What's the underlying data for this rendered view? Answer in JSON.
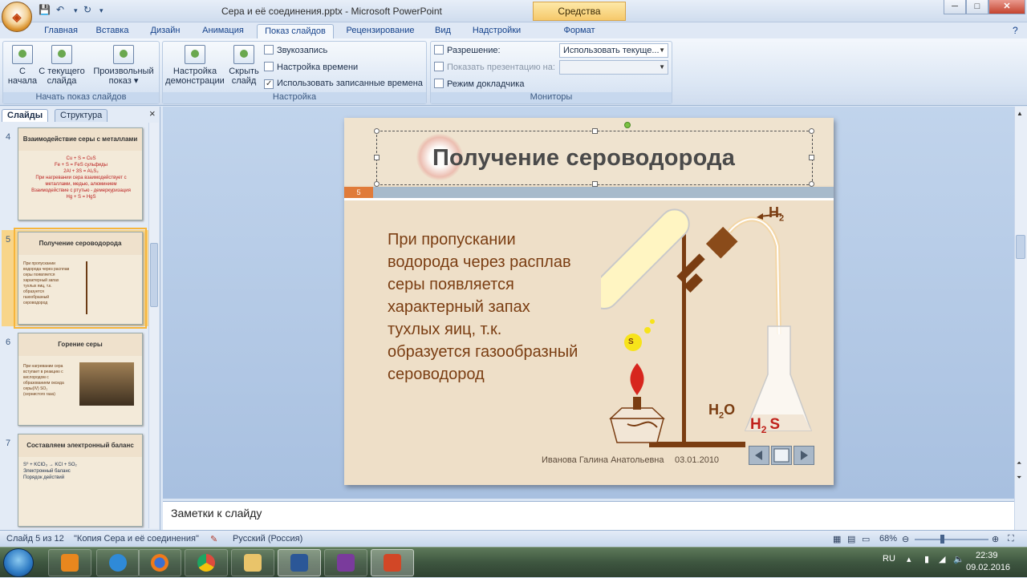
{
  "window": {
    "title": "Сера и её соединения.pptx - Microsoft PowerPoint",
    "context_tab": "Средства рисования"
  },
  "qat": {
    "save": "💾",
    "undo": "↶",
    "redo": "↻"
  },
  "tabs": [
    "Главная",
    "Вставка",
    "Дизайн",
    "Анимация",
    "Показ слайдов",
    "Рецензирование",
    "Вид",
    "Надстройки",
    "Формат"
  ],
  "active_tab": "Показ слайдов",
  "ribbon": {
    "group1": {
      "label": "Начать показ слайдов",
      "btn_from_start": "С\nначала",
      "btn_from_current": "С текущего\nслайда",
      "btn_custom": "Произвольный\nпоказ ▾"
    },
    "group2": {
      "label": "Настройка",
      "btn_setup": "Настройка\nдемонстрации",
      "btn_hide": "Скрыть\nслайд",
      "record_narration": "Звукозапись",
      "rehearse": "Настройка времени",
      "use_timings": "Использовать записанные времена"
    },
    "group3": {
      "label": "Мониторы",
      "resolution_label": "Разрешение:",
      "resolution_value": "Использовать текуще...",
      "show_on_label": "Показать презентацию на:",
      "show_on_value": "",
      "presenter_view": "Режим докладчика"
    }
  },
  "left_pane": {
    "tab_slides": "Слайды",
    "tab_outline": "Структура",
    "close": "×",
    "thumbs": [
      {
        "num": "4",
        "title": "Взаимодействие серы с металлами",
        "body": "Cu + S = CuS\nFe + S = FeS   сульфиды\n2Al + 3S = Al₂S₃\nПри нагревании сера взаимодействует с металлами, медью, алюминием\nВзаимодействие с ртутью - демеркуризация\nHg + S = HgS"
      },
      {
        "num": "5",
        "title": "Получение сероводорода",
        "body": "При пропускании водорода через расплав серы появляется характерный запах тухлых яиц, т.к. образуется газообразный сероводород"
      },
      {
        "num": "6",
        "title": "Горение серы",
        "body": "При нагревании сера вступает в реакцию с кислородом с образованием оксида серы(IV) SO₂ (сернистого газа)"
      },
      {
        "num": "7",
        "title": "Составляем электронный баланс",
        "body": "S⁰ + KClO₃ → KCl + SO₂\nЭлектронный баланс\nПорядок действий"
      }
    ]
  },
  "slide": {
    "title": "Получение сероводорода",
    "number": "5",
    "text": "При пропускании водорода через расплав серы появляется характерный запах тухлых яиц, т.к. образуется газообразный сероводород",
    "author": "Иванова Галина Анатольевна",
    "date": "03.01.2010",
    "label_h2": "H",
    "label_h2_sub": "2",
    "label_h2o": "H",
    "label_h2o_sub": "2",
    "label_h2o_tail": "O",
    "label_h2s": "H",
    "label_h2s_sub": "2",
    "label_h2s_tail": "S",
    "label_sulfur": "S"
  },
  "notes": {
    "placeholder": "Заметки к слайду"
  },
  "statusbar": {
    "slide_info": "Слайд 5 из 12",
    "theme": "\"Копия Сера и её соединения\"",
    "language": "Русский (Россия)",
    "zoom": "68%"
  },
  "taskbar": {
    "lang": "RU",
    "time": "22:39",
    "date": "09.02.2016"
  },
  "colors": {
    "accent": "#e07b3a",
    "slide_bg": "#eedfc8",
    "text_brown": "#7a3d12",
    "red_formula": "#c0211b"
  }
}
